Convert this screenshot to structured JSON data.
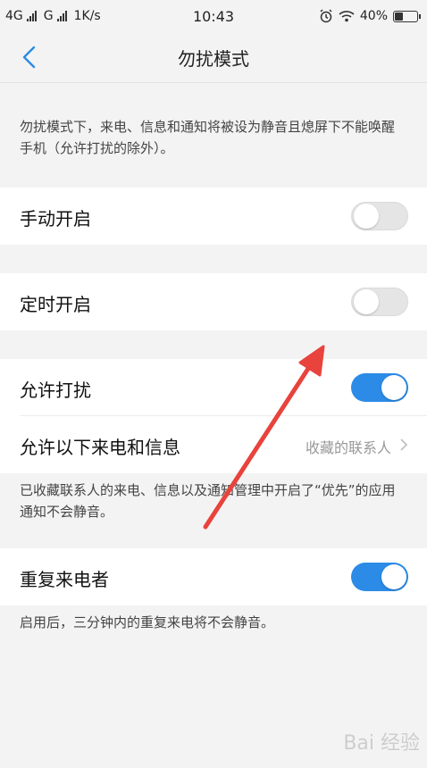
{
  "status": {
    "network1": "4G",
    "network2": "G",
    "speed": "1K/s",
    "time": "10:43",
    "battery": "40%",
    "battery_level": 0.4
  },
  "nav": {
    "title": "勿扰模式"
  },
  "intro": "勿扰模式下，来电、信息和通知将被设为静音且熄屏下不能唤醒手机（允许打扰的除外）。",
  "settings": {
    "manual": {
      "label": "手动开启",
      "enabled": false
    },
    "scheduled": {
      "label": "定时开启",
      "enabled": false
    },
    "allow": {
      "label": "允许打扰",
      "enabled": true
    },
    "allow_from": {
      "label": "允许以下来电和信息",
      "value": "收藏的联系人"
    },
    "allow_note": "已收藏联系人的来电、信息以及通知管理中开启了“优先”的应用通知不会静音。",
    "repeat": {
      "label": "重复来电者",
      "enabled": true
    },
    "repeat_note": "启用后，三分钟内的重复来电将不会静音。"
  },
  "colors": {
    "accent": "#2b8be6",
    "annotation_arrow": "#e8433c"
  },
  "watermark": "Bai 经验"
}
